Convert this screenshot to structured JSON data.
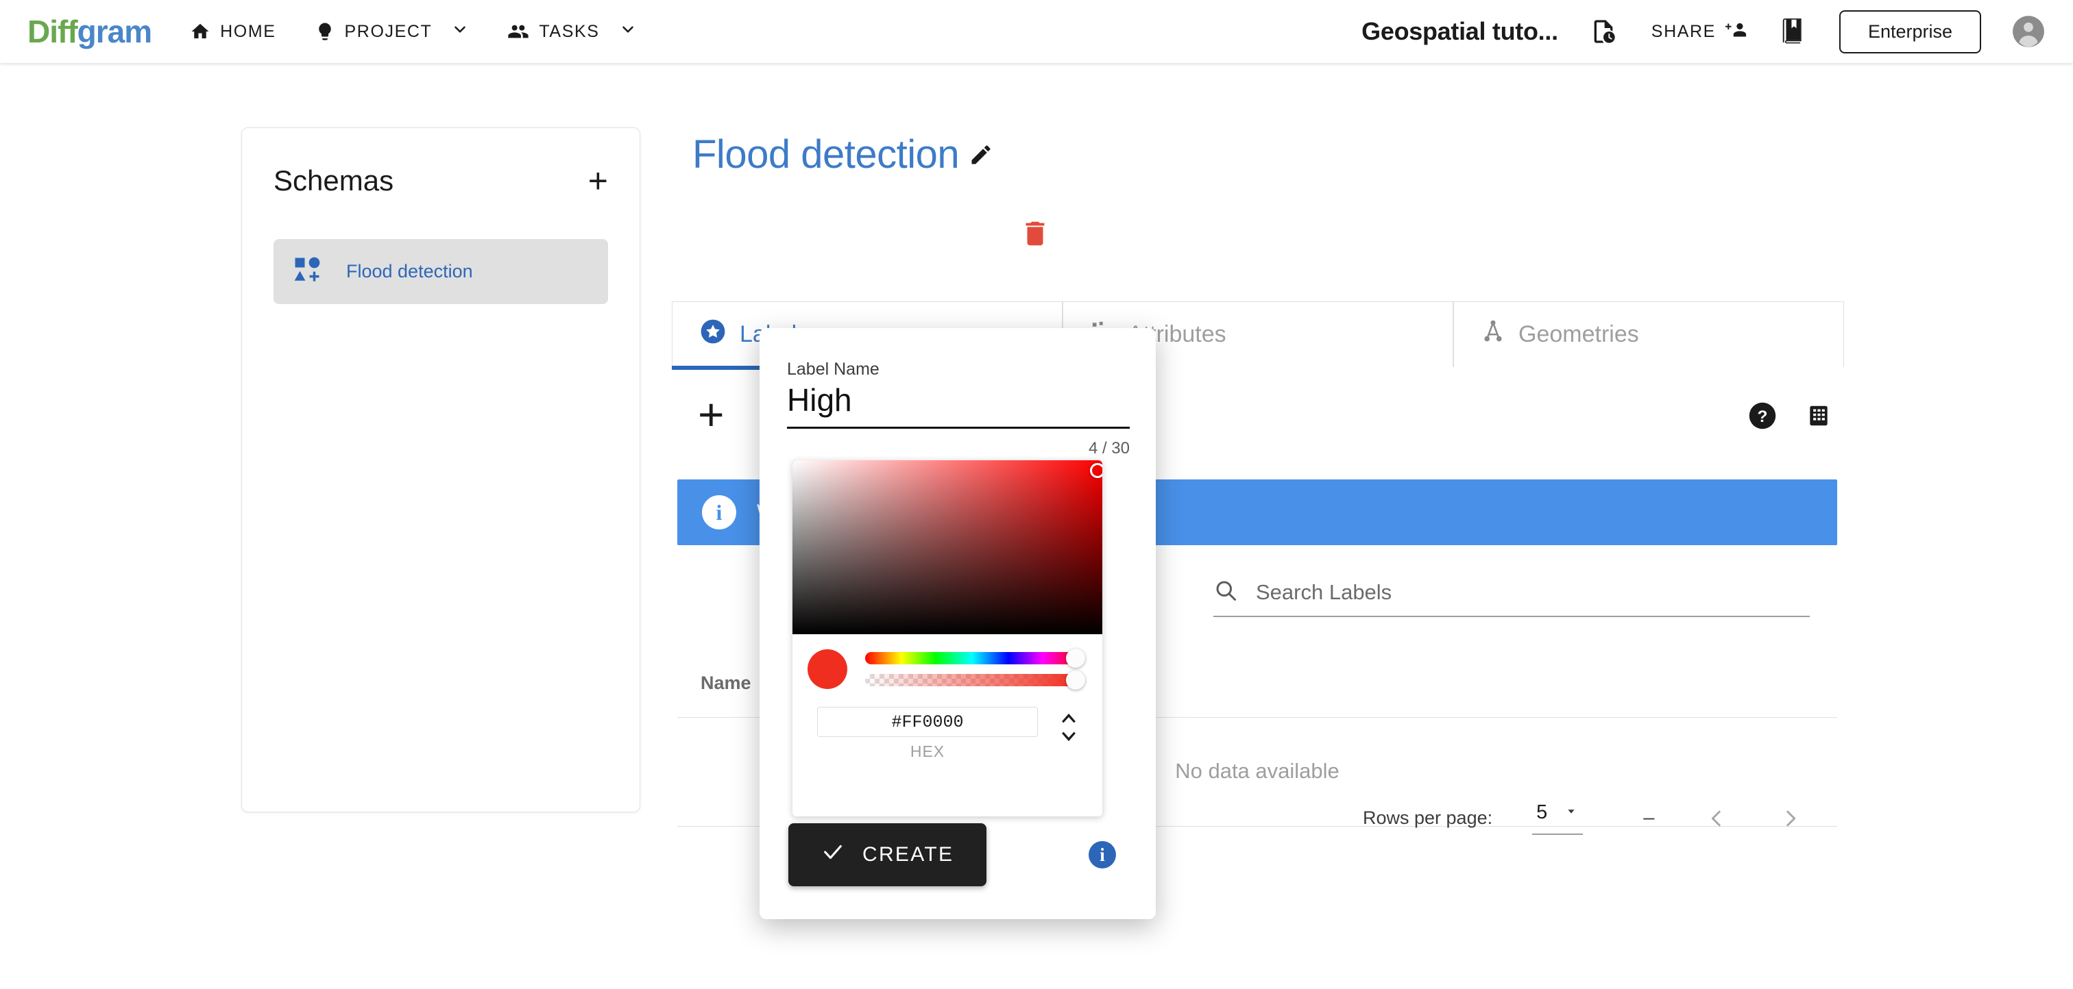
{
  "nav": {
    "logo_part1": "Diff",
    "logo_part2": "gram",
    "items": [
      {
        "label": "HOME",
        "icon": "home-icon"
      },
      {
        "label": "PROJECT",
        "icon": "lightbulb-icon"
      },
      {
        "label": "TASKS",
        "icon": "people-icon"
      }
    ],
    "project_title": "Geospatial tuto...",
    "share_label": "SHARE",
    "enterprise_label": "Enterprise",
    "icons": {
      "file_history": "file-clock-icon",
      "share_people": "person-add-icon",
      "guide": "bookmark-book-icon",
      "avatar": "account-circle-icon"
    }
  },
  "schemas": {
    "title": "Schemas",
    "add_label": "+",
    "items": [
      {
        "label": "Flood detection",
        "icon": "shapes-add-icon"
      }
    ]
  },
  "main": {
    "title": "Flood detection",
    "edit_icon": "pencil-icon",
    "delete_icon": "trash-icon",
    "tabs": [
      {
        "label": "Labels",
        "icon": "star-circle-icon",
        "active": true
      },
      {
        "label": "Attributes",
        "icon": "attribute-tree-icon",
        "active": false
      },
      {
        "label": "Geometries",
        "icon": "geometry-icon",
        "active": false
      }
    ],
    "toolbar": {
      "add_label": "+",
      "help_icon": "help-circle-icon",
      "grid_icon": "grid-view-icon"
    },
    "banner": {
      "icon": "info-icon",
      "text": "Welcome! Let's create your first label.",
      "color": "#4890E8"
    },
    "search": {
      "placeholder": "Search Labels",
      "value": "",
      "icon": "search-icon"
    },
    "table": {
      "columns": [
        "Name"
      ],
      "empty_message": "No data available",
      "rows": []
    },
    "pagination": {
      "rows_per_page_label": "Rows per page:",
      "rows_per_page_value": "5",
      "range_text": "–",
      "prev_icon": "chevron-left-icon",
      "next_icon": "chevron-right-icon"
    }
  },
  "dialog": {
    "field_label": "Label Name",
    "name_value": "High",
    "name_placeholder": "Label Name",
    "counter": "4 / 30",
    "color": {
      "hex_value": "#FF0000",
      "hex_caption": "HEX",
      "swatch_color": "#F02E20",
      "base_hue_color": "#FF0000"
    },
    "create_label": "CREATE",
    "create_icon": "check-icon",
    "info_icon": "info-icon"
  }
}
